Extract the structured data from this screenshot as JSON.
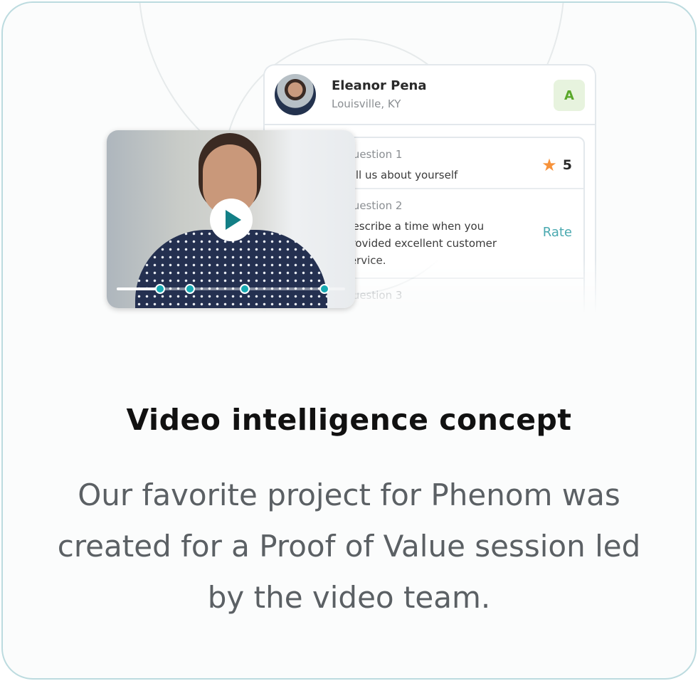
{
  "candidate": {
    "name": "Eleanor Pena",
    "location": "Louisville, KY",
    "grade": "A"
  },
  "questions": [
    {
      "label": "Question 1",
      "text": "Tell us about yourself",
      "score": "5"
    },
    {
      "label": "Question 2",
      "text": "Describe a time when you provided excellent customer service.",
      "action": "Rate"
    },
    {
      "label": "Question 3"
    }
  ],
  "video": {
    "progress": 0.19,
    "markers": [
      0.19,
      0.32,
      0.56,
      0.91
    ],
    "accent": "#17a9b2"
  },
  "caption": {
    "title": "Video intelligence concept",
    "description": "Our favorite project for Phenom was created for a Proof of Value session led by the video team."
  }
}
